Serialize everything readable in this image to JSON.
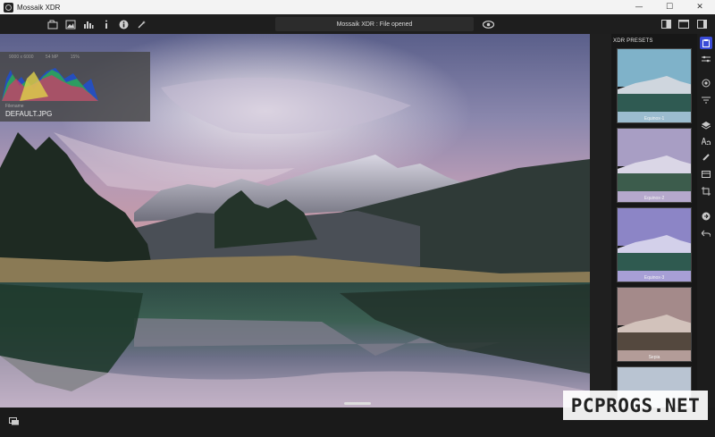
{
  "window": {
    "title": "Mossaik XDR",
    "minimize": "—",
    "maximize": "☐",
    "close": "✕"
  },
  "toolbar": {
    "status": "Mossaik XDR : File opened"
  },
  "histogram": {
    "dimensions": "9000 x 6000",
    "megapixels": "54 MP",
    "percent": "15%",
    "filename_label": "Filename",
    "filename": "DEFAULT.JPG"
  },
  "presets": {
    "title": "XDR PRESETS",
    "items": [
      {
        "label": "Equinox-1"
      },
      {
        "label": "Equinox-2"
      },
      {
        "label": "Equinox-3"
      },
      {
        "label": "Sepia"
      },
      {
        "label": ""
      }
    ]
  },
  "watermark": "PCPROGS.NET",
  "colors": {
    "accent": "#3a4bd6",
    "background": "#1b1b1b"
  }
}
